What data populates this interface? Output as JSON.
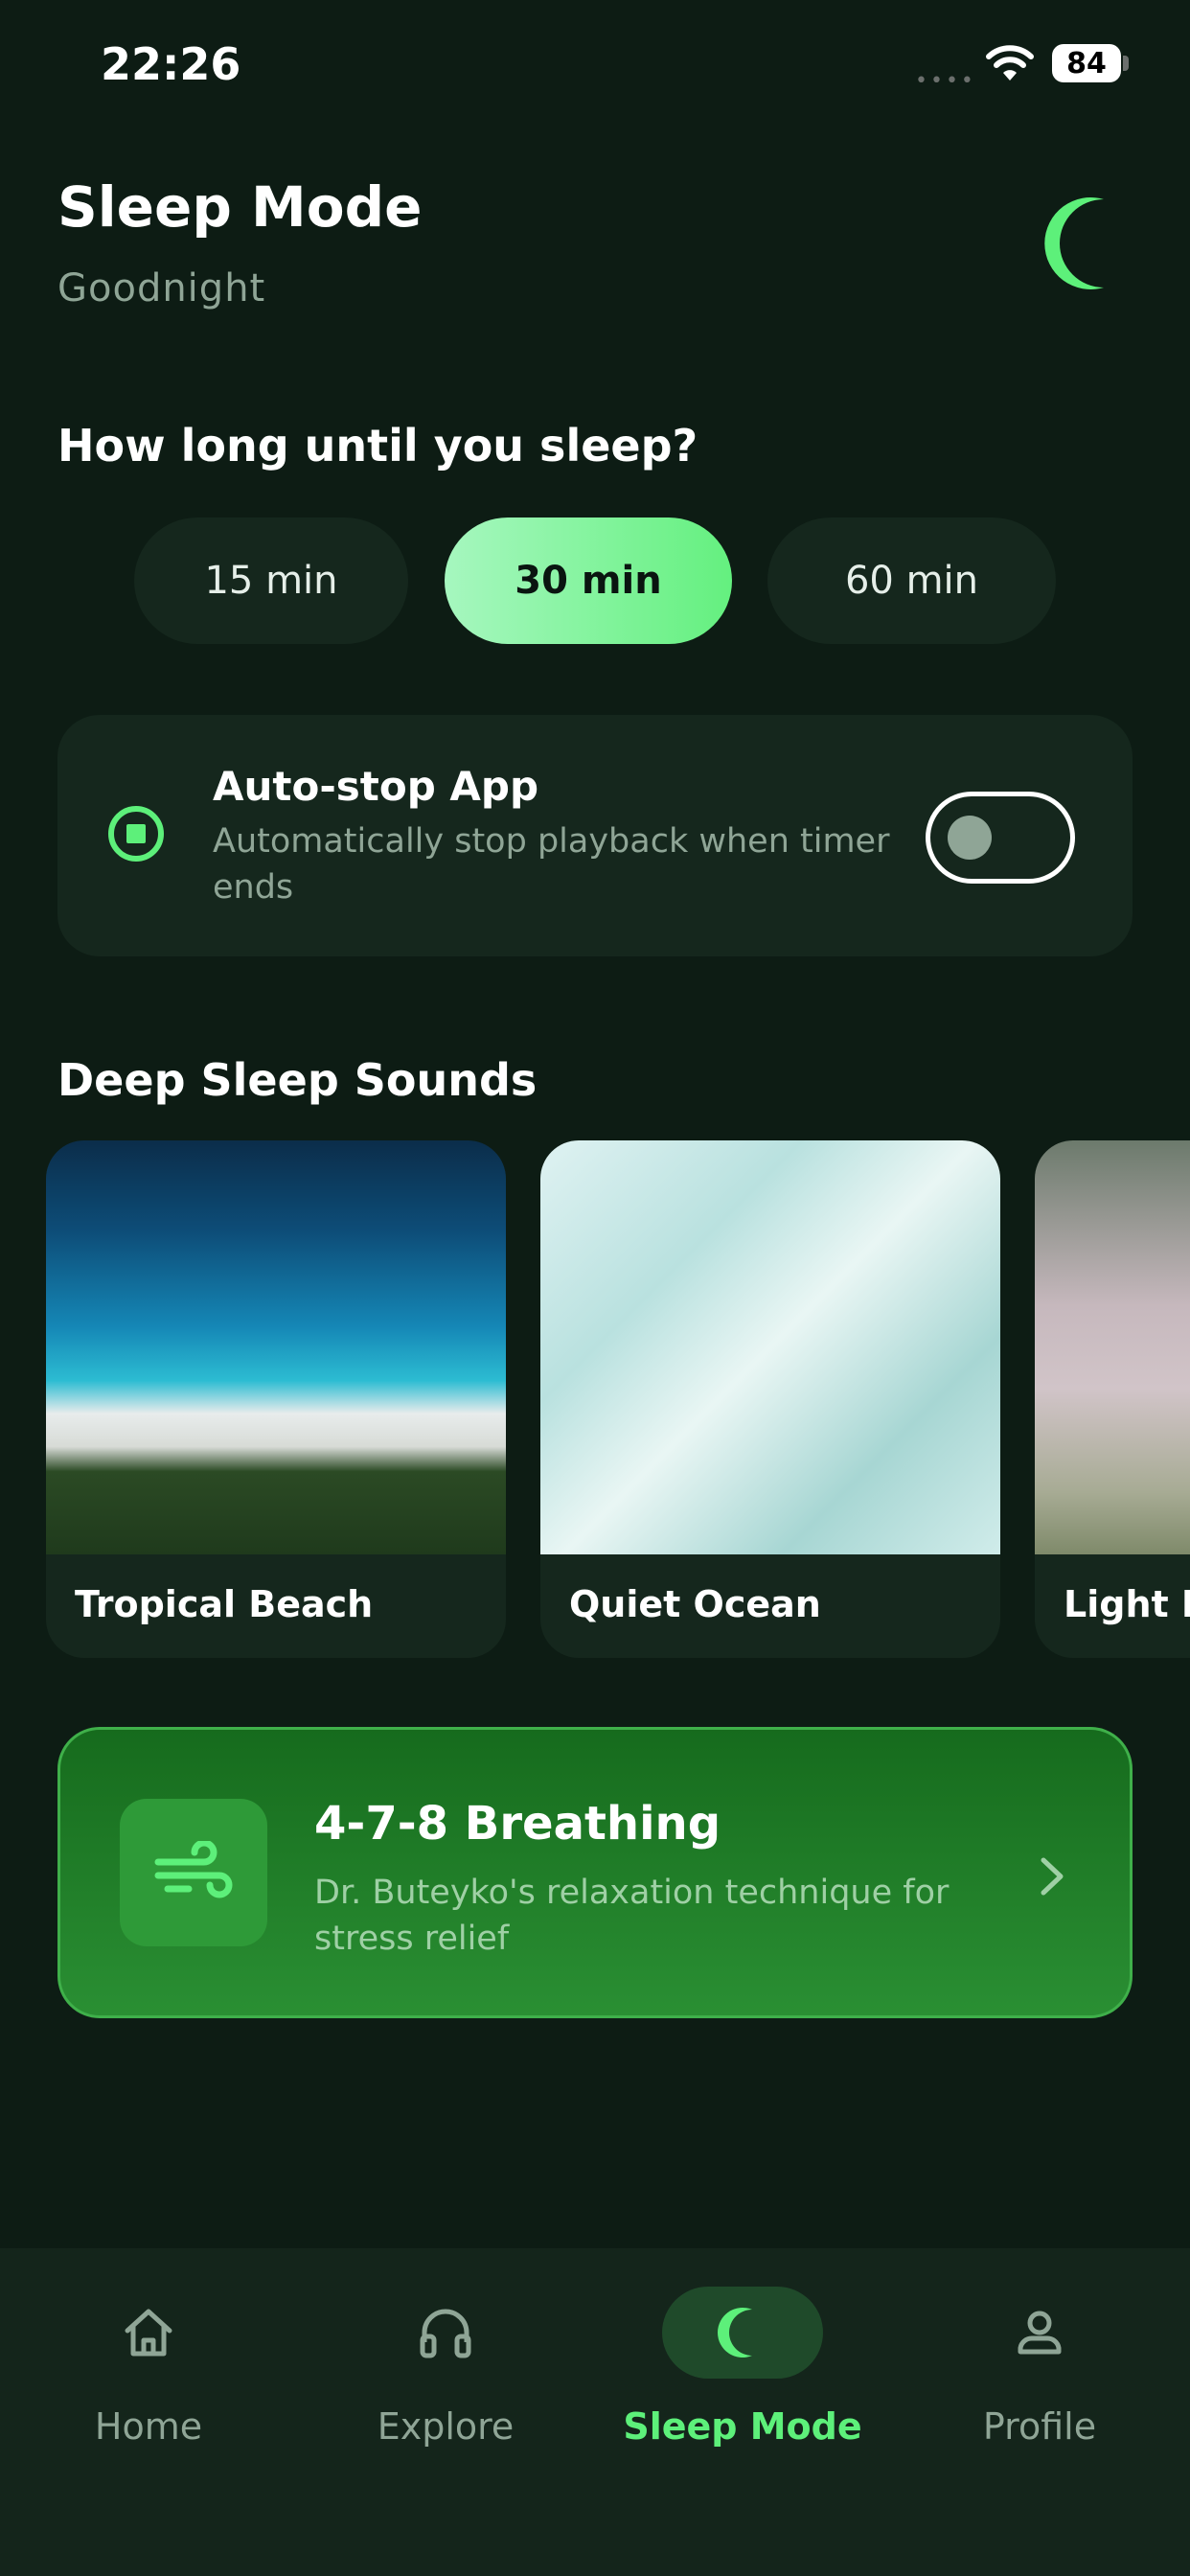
{
  "status_bar": {
    "time": "22:26",
    "signal": "••••",
    "battery": "84"
  },
  "header": {
    "title": "Sleep Mode",
    "subtitle": "Goodnight"
  },
  "timer": {
    "question": "How long until you sleep?",
    "options": [
      "15 min",
      "30 min",
      "60 min"
    ],
    "selected": "30 min"
  },
  "auto_stop": {
    "title": "Auto-stop App",
    "description": "Automatically stop playback when timer ends",
    "enabled": false
  },
  "deep_sleep": {
    "heading": "Deep Sleep Sounds",
    "cards": [
      {
        "label": "Tropical Beach"
      },
      {
        "label": "Quiet Ocean"
      },
      {
        "label": "Light R"
      }
    ]
  },
  "breathing": {
    "title": "4-7-8 Breathing",
    "description": "Dr. Buteyko's relaxation technique for stress relief"
  },
  "nav": {
    "items": [
      {
        "label": "Home",
        "icon": "home-icon"
      },
      {
        "label": "Explore",
        "icon": "headphones-icon"
      },
      {
        "label": "Sleep Mode",
        "icon": "moon-icon"
      },
      {
        "label": "Profile",
        "icon": "profile-icon"
      }
    ],
    "active": "Sleep Mode"
  },
  "colors": {
    "background": "#0d1c14",
    "accent": "#5df07a",
    "card": "#15271d",
    "breathing_card": "#1e7d27"
  }
}
